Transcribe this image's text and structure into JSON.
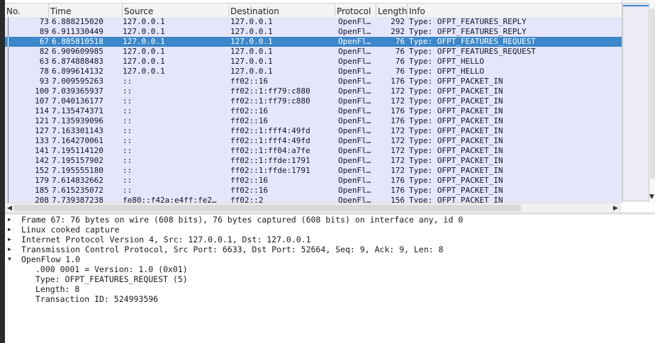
{
  "columns": {
    "no": "No.",
    "time": "Time",
    "source": "Source",
    "destination": "Destination",
    "protocol": "Protocol",
    "length": "Length",
    "info": "Info"
  },
  "packets": [
    {
      "no": "73",
      "time": "6.888215020",
      "src": "127.0.0.1",
      "dst": "127.0.0.1",
      "proto": "OpenFl…",
      "len": "292",
      "info": "Type: OFPT_FEATURES_REPLY"
    },
    {
      "no": "89",
      "time": "6.911330449",
      "src": "127.0.0.1",
      "dst": "127.0.0.1",
      "proto": "OpenFl…",
      "len": "292",
      "info": "Type: OFPT_FEATURES_REPLY"
    },
    {
      "no": "67",
      "time": "6.885810518",
      "src": "127.0.0.1",
      "dst": "127.0.0.1",
      "proto": "OpenFl…",
      "len": "76",
      "info": "Type: OFPT_FEATURES_REQUEST"
    },
    {
      "no": "82",
      "time": "6.909609985",
      "src": "127.0.0.1",
      "dst": "127.0.0.1",
      "proto": "OpenFl…",
      "len": "76",
      "info": "Type: OFPT_FEATURES_REQUEST"
    },
    {
      "no": "63",
      "time": "6.874888483",
      "src": "127.0.0.1",
      "dst": "127.0.0.1",
      "proto": "OpenFl…",
      "len": "76",
      "info": "Type: OFPT_HELLO"
    },
    {
      "no": "78",
      "time": "6.899614132",
      "src": "127.0.0.1",
      "dst": "127.0.0.1",
      "proto": "OpenFl…",
      "len": "76",
      "info": "Type: OFPT_HELLO"
    },
    {
      "no": "93",
      "time": "7.009595263",
      "src": "::",
      "dst": "ff02::16",
      "proto": "OpenFl…",
      "len": "176",
      "info": "Type: OFPT_PACKET_IN"
    },
    {
      "no": "100",
      "time": "7.039365937",
      "src": "::",
      "dst": "ff02::1:ff79:c880",
      "proto": "OpenFl…",
      "len": "172",
      "info": "Type: OFPT_PACKET_IN"
    },
    {
      "no": "107",
      "time": "7.040136177",
      "src": "::",
      "dst": "ff02::1:ff79:c880",
      "proto": "OpenFl…",
      "len": "172",
      "info": "Type: OFPT_PACKET_IN"
    },
    {
      "no": "114",
      "time": "7.135474371",
      "src": "::",
      "dst": "ff02::16",
      "proto": "OpenFl…",
      "len": "176",
      "info": "Type: OFPT_PACKET_IN"
    },
    {
      "no": "121",
      "time": "7.135939096",
      "src": "::",
      "dst": "ff02::16",
      "proto": "OpenFl…",
      "len": "176",
      "info": "Type: OFPT_PACKET_IN"
    },
    {
      "no": "127",
      "time": "7.163301143",
      "src": "::",
      "dst": "ff02::1:fff4:49fd",
      "proto": "OpenFl…",
      "len": "172",
      "info": "Type: OFPT_PACKET_IN"
    },
    {
      "no": "133",
      "time": "7.164270061",
      "src": "::",
      "dst": "ff02::1:fff4:49fd",
      "proto": "OpenFl…",
      "len": "172",
      "info": "Type: OFPT_PACKET_IN"
    },
    {
      "no": "141",
      "time": "7.195114120",
      "src": "::",
      "dst": "ff02::1:ff04:a7fe",
      "proto": "OpenFl…",
      "len": "172",
      "info": "Type: OFPT_PACKET_IN"
    },
    {
      "no": "142",
      "time": "7.195157902",
      "src": "::",
      "dst": "ff02::1:ffde:1791",
      "proto": "OpenFl…",
      "len": "172",
      "info": "Type: OFPT_PACKET_IN"
    },
    {
      "no": "152",
      "time": "7.195555180",
      "src": "::",
      "dst": "ff02::1:ffde:1791",
      "proto": "OpenFl…",
      "len": "172",
      "info": "Type: OFPT_PACKET_IN"
    },
    {
      "no": "179",
      "time": "7.614832662",
      "src": "::",
      "dst": "ff02::16",
      "proto": "OpenFl…",
      "len": "176",
      "info": "Type: OFPT_PACKET_IN"
    },
    {
      "no": "185",
      "time": "7.615235072",
      "src": "::",
      "dst": "ff02::16",
      "proto": "OpenFl…",
      "len": "176",
      "info": "Type: OFPT_PACKET_IN"
    },
    {
      "no": "208",
      "time": "7.739387238",
      "src": "fe80::f42a:e4ff:fe2…",
      "dst": "ff02::2",
      "proto": "OpenFl…",
      "len": "156",
      "info": "Type: OFPT_PACKET_IN"
    }
  ],
  "selected_packet_no": "67",
  "details": [
    {
      "expander": "▶",
      "text": "Frame 67: 76 bytes on wire (608 bits), 76 bytes captured (608 bits) on interface any, id 0"
    },
    {
      "expander": "▶",
      "text": "Linux cooked capture"
    },
    {
      "expander": "▶",
      "text": "Internet Protocol Version 4, Src: 127.0.0.1, Dst: 127.0.0.1"
    },
    {
      "expander": "▶",
      "text": "Transmission Control Protocol, Src Port: 6633, Dst Port: 52664, Seq: 9, Ack: 9, Len: 8"
    },
    {
      "expander": "▼",
      "text": "OpenFlow 1.0"
    }
  ],
  "openflow_fields": [
    ".000 0001 = Version: 1.0 (0x01)",
    "Type: OFPT_FEATURES_REQUEST (5)",
    "Length: 8",
    "Transaction ID: 524993596"
  ],
  "scrollbar": {
    "left_arrow": "◀",
    "right_arrow": "▶",
    "down_arrow": "▼"
  },
  "colors": {
    "row_bg": "#e6e6fa",
    "selected_bg": "#3b87c9"
  }
}
